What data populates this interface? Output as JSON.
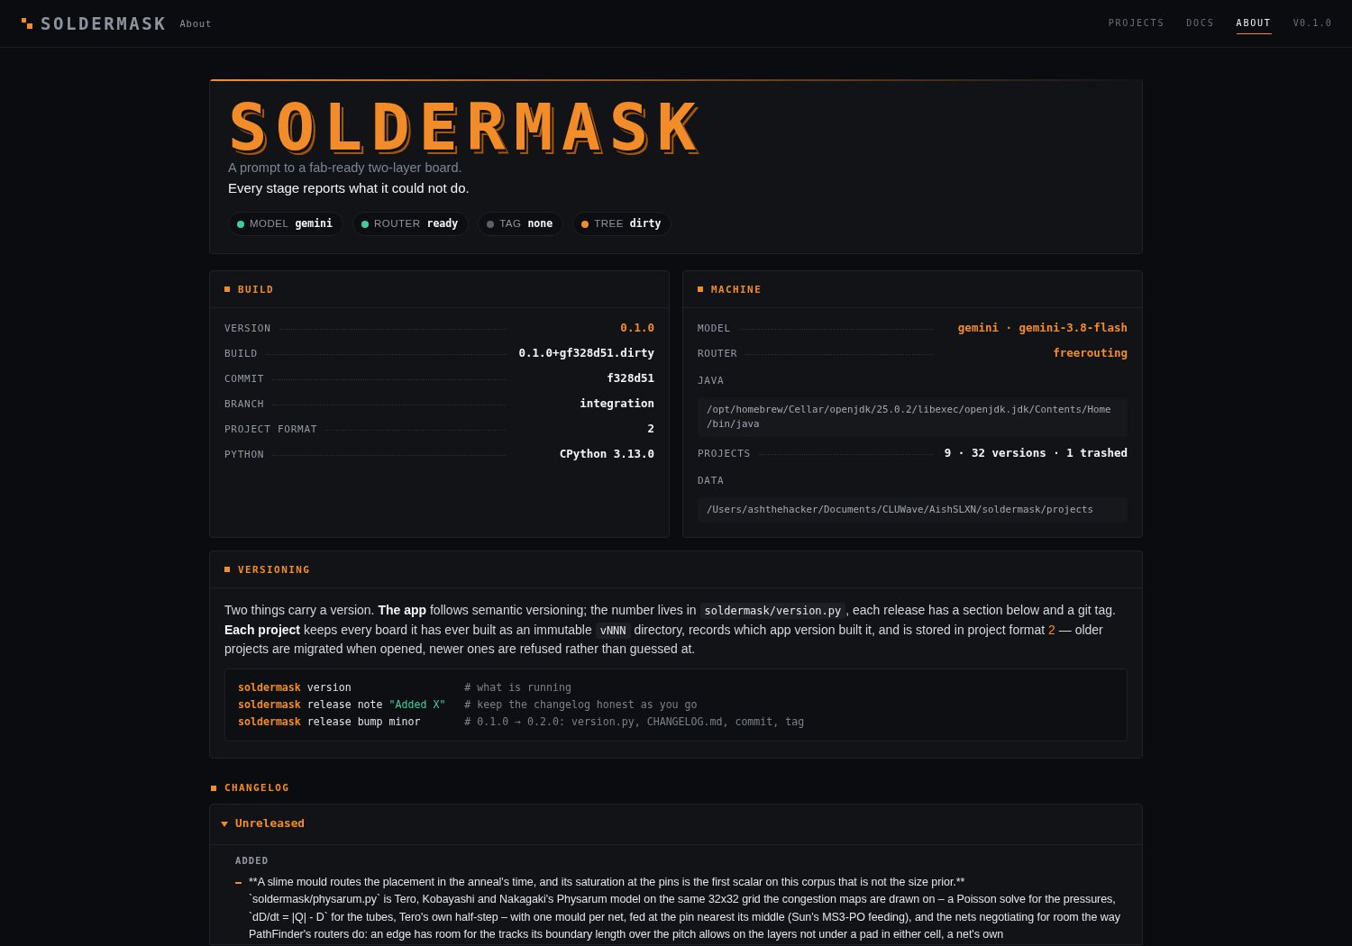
{
  "nav": {
    "logo": "SOLDERMASK",
    "page": "About",
    "links": [
      {
        "label": "PROJECTS",
        "selected": false
      },
      {
        "label": "DOCS",
        "selected": false
      },
      {
        "label": "ABOUT",
        "selected": true
      }
    ],
    "version": "V0.1.0"
  },
  "hero": {
    "wordmark": "SOLDERMASK",
    "tagline": "A prompt to a fab-ready two-layer board.",
    "motto": "Every stage reports what it could not do.",
    "pills": [
      {
        "label": "MODEL",
        "value": "gemini",
        "color": "#3ecf9a"
      },
      {
        "label": "ROUTER",
        "value": "ready",
        "color": "#3ecf9a"
      },
      {
        "label": "TAG",
        "value": "none",
        "color": "#5c616c"
      },
      {
        "label": "TREE",
        "value": "dirty",
        "color": "#f28c28"
      }
    ]
  },
  "build": {
    "title": "BUILD",
    "rows": [
      {
        "kind": "pair",
        "label": "VERSION",
        "value": "0.1.0",
        "highlight": true
      },
      {
        "kind": "pair",
        "label": "BUILD",
        "value": "0.1.0+gf328d51.dirty",
        "highlight": false
      },
      {
        "kind": "pair",
        "label": "COMMIT",
        "value": "f328d51",
        "highlight": false
      },
      {
        "kind": "pair",
        "label": "BRANCH",
        "value": "integration",
        "highlight": false
      },
      {
        "kind": "pair",
        "label": "PROJECT FORMAT",
        "value": "2",
        "highlight": false
      },
      {
        "kind": "pair",
        "label": "PYTHON",
        "value": "CPython 3.13.0",
        "highlight": false
      }
    ]
  },
  "machine": {
    "title": "MACHINE",
    "rows": [
      {
        "kind": "pair",
        "label": "MODEL",
        "value": "gemini · gemini-3.8-flash",
        "highlight": true
      },
      {
        "kind": "pair",
        "label": "ROUTER",
        "value": "freerouting",
        "highlight": true
      },
      {
        "kind": "path",
        "label": "JAVA",
        "value": "/opt/homebrew/Cellar/openjdk/25.0.2/libexec/openjdk.jdk/Contents/Home/bin/java",
        "highlight": false
      },
      {
        "kind": "pair",
        "label": "PROJECTS",
        "value": "9 · 32 versions · 1 trashed",
        "highlight": false
      },
      {
        "kind": "path",
        "label": "DATA",
        "value": "/Users/ashthehacker/Documents/CLUWave/AishSLXN/soldermask/projects",
        "highlight": false
      }
    ]
  },
  "versioning": {
    "title": "VERSIONING",
    "paragraph": [
      {
        "kind": "text",
        "text": "Two things carry a version. "
      },
      {
        "kind": "bold",
        "text": "The app"
      },
      {
        "kind": "text",
        "text": " follows semantic versioning; the number lives in "
      },
      {
        "kind": "code",
        "text": "soldermask/version.py"
      },
      {
        "kind": "text",
        "text": ", each release has a section below and a git tag. "
      },
      {
        "kind": "bold",
        "text": "Each project"
      },
      {
        "kind": "text",
        "text": " keeps every board it has ever built as an immutable "
      },
      {
        "kind": "code",
        "text": "vNNN"
      },
      {
        "kind": "text",
        "text": " directory, records which app version built it, and is stored in project format "
      },
      {
        "kind": "accent",
        "text": "2"
      },
      {
        "kind": "text",
        "text": " — older projects are migrated when opened, newer ones are refused rather than guessed at."
      }
    ],
    "code": [
      {
        "command": "soldermask",
        "args": "version",
        "comment": "# what is running"
      },
      {
        "command": "soldermask",
        "args": "release note",
        "string": "\"Added X\"",
        "comment": "# keep the changelog honest as you go"
      },
      {
        "command": "soldermask",
        "args": "release bump minor",
        "comment": "# 0.1.0 → 0.2.0: version.py, CHANGELOG.md, commit, tag"
      }
    ]
  },
  "changelog": {
    "title": "CHANGELOG",
    "releases": [
      {
        "title": "Unreleased",
        "expanded": true,
        "sections": [
          {
            "title": "ADDED",
            "items": [
              "**A slime mould routes the placement in the anneal's time, and its saturation at the pins is the first scalar on this corpus that is not the size prior.**\n`soldermask/physarum.py` is Tero, Kobayashi and Nakagaki's Physarum model on the same 32x32 grid the congestion maps are drawn on – a Poisson solve for the pressures, `dD/dt = |Q| - D` for the tubes, Tero's own half-step – with one mould per net, fed at the pin nearest its middle (Sun's MS3-PO feeding), and the nets negotiating for room the way PathFinder's routers do: an edge has room for the tracks its boundary length over the pitch allows on the layers not under a pad in either cell, a net's own"
            ]
          }
        ]
      }
    ]
  }
}
